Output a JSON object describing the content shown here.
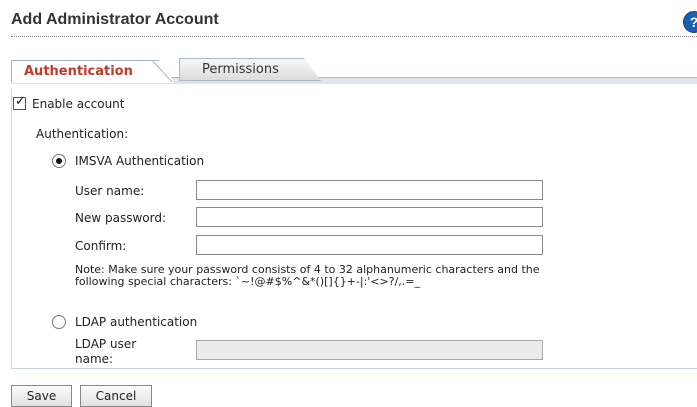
{
  "header": {
    "title": "Add Administrator Account",
    "help_icon_glyph": "?"
  },
  "tabs": [
    {
      "label": "Authentication",
      "active": true
    },
    {
      "label": "Permissions",
      "active": false
    }
  ],
  "form": {
    "enable_account": {
      "label": "Enable account",
      "checked": true
    },
    "authentication_heading": "Authentication:",
    "imsva": {
      "label": "IMSVA Authentication",
      "selected": true,
      "fields": [
        {
          "label": "User name:",
          "value": ""
        },
        {
          "label": "New password:",
          "value": ""
        },
        {
          "label": "Confirm:",
          "value": ""
        }
      ],
      "note_line1": "Note: Make sure your password consists of 4 to 32 alphanumeric characters and the",
      "note_line2": "following special characters: `~!@#$%^&*()[]{}+-|:'<>?/,.=_"
    },
    "ldap": {
      "label": "LDAP authentication",
      "selected": false,
      "user_name_label_line1": "LDAP user",
      "user_name_label_line2": "name:",
      "user_name_value": ""
    }
  },
  "buttons": {
    "save": "Save",
    "cancel": "Cancel"
  },
  "colors": {
    "active_tab_text": "#c0392b",
    "help_icon": "#1a5fb4"
  }
}
